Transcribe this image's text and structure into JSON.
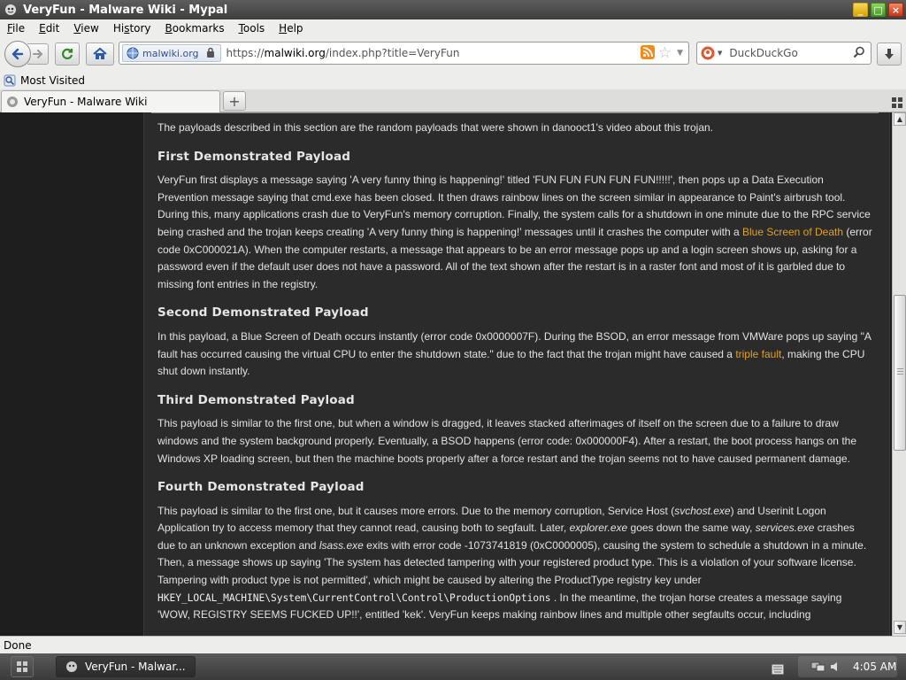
{
  "window": {
    "title": "VeryFun - Malware Wiki - Mypal"
  },
  "menu": [
    {
      "u": "F",
      "rest": "ile"
    },
    {
      "u": "E",
      "rest": "dit"
    },
    {
      "u": "V",
      "rest": "iew"
    },
    {
      "u": "",
      "rest": "Hi",
      "u2": "s",
      "rest2": "tory"
    },
    {
      "u": "B",
      "rest": "ookmarks"
    },
    {
      "u": "T",
      "rest": "ools"
    },
    {
      "u": "H",
      "rest": "elp"
    }
  ],
  "nav": {
    "identity": "malwiki.org",
    "url_prefix": "https://",
    "url_host": "malwiki.org",
    "url_path": "/index.php?title=VeryFun",
    "search_engine": "DuckDuckGo"
  },
  "bookmarks": {
    "most_visited": "Most Visited"
  },
  "tabs": [
    {
      "title": "VeryFun - Malware Wiki"
    }
  ],
  "article": {
    "intro": "The payloads described in this section are the random payloads that were shown in danooct1's video about this trojan.",
    "h1": "First Demonstrated Payload",
    "p1a": "VeryFun first displays a message saying 'A very funny thing is happening!' titled 'FUN FUN FUN FUN FUN!!!!!', then pops up a Data Execution Prevention message saying that cmd.exe has been closed. It then draws rainbow lines on the screen similar in appearance to Paint's airbrush tool. During this, many applications crash due to VeryFun's memory corruption. Finally, the system calls for a shutdown in one minute due to the RPC service being crashed and the trojan keeps creating 'A very funny thing is happening!' messages until it crashes the computer with a ",
    "p1_link": "Blue Screen of Death",
    "p1b": " (error code 0xC000021A). When the computer restarts, a message that appears to be an error message pops up and a login screen shows up, asking for a password even if the default user does not have a password. All of the text shown after the restart is in a raster font and most of it is garbled due to missing font entries in the registry.",
    "h2": "Second Demonstrated Payload",
    "p2a": "In this payload, a Blue Screen of Death occurs instantly (error code 0x0000007F). During the BSOD, an error message from VMWare pops up saying \"A fault has occurred causing the virtual CPU to enter the shutdown state.\" due to the fact that the trojan might have caused a ",
    "p2_link": "triple fault",
    "p2b": ", making the CPU shut down instantly.",
    "h3": "Third Demonstrated Payload",
    "p3": "This payload is similar to the first one, but when a window is dragged, it leaves stacked afterimages of itself on the screen due to a failure to draw windows and the system background properly. Eventually, a BSOD happens (error code: 0x000000F4). After a restart, the boot process hangs on the Windows XP loading screen, but then the machine boots properly after a force restart and the trojan seems not to have caused permanent damage.",
    "h4": "Fourth Demonstrated Payload",
    "p4a": "This payload is similar to the first one, but it causes more errors. Due to the memory corruption, Service Host (",
    "p4_svchost": "svchost.exe",
    "p4b": ") and Userinit Logon Application try to access memory that they cannot read, causing both to segfault. Later, ",
    "p4_explorer": "explorer.exe",
    "p4c": " goes down the same way, ",
    "p4_services": "services.exe",
    "p4d": " crashes due to an unknown exception and ",
    "p4_lsass": "lsass.exe",
    "p4e": " exits with error code -1073741819 (0xC0000005), causing the system to schedule a shutdown in a minute. Then, a message shows up saying 'The system has detected tampering with your registered product type. This is a violation of your software license. Tampering with product type is not permitted', which might be caused by altering the ProductType registry key under ",
    "p4_key": "HKEY_LOCAL_MACHINE\\System\\CurrentControl\\Control\\ProductionOptions",
    "p4f": ". In the meantime, the trojan horse creates a message saying 'WOW, REGISTRY SEEMS FUCKED UP!!', entitled 'kek'. VeryFun keeps making rainbow lines and multiple other segfaults occur, including"
  },
  "status": {
    "text": "Done"
  },
  "taskbar": {
    "task_title": "VeryFun - Malwar...",
    "clock": "4:05 AM"
  },
  "colors": {
    "link": "#e0a020",
    "page_bg": "#2b2b2b",
    "text": "#e2e2e2"
  }
}
